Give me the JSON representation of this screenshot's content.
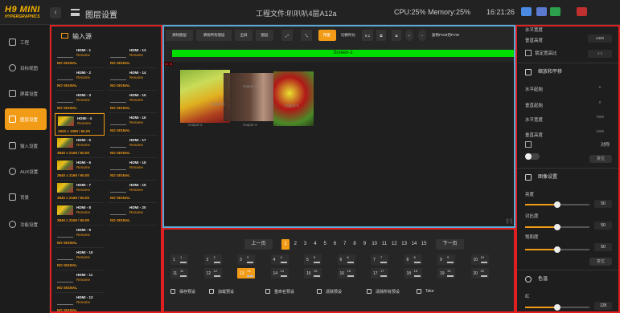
{
  "app": {
    "logo": "H9 MINI",
    "logo_sub": "HYPERGRAPHICS",
    "menu_title": "图层设置",
    "project": "工程文件:叭叭叭4层A12a",
    "cpu": "CPU:25% Memory:25%",
    "clock": "16:21:26"
  },
  "nav": {
    "items": [
      {
        "label": "工程"
      },
      {
        "label": "目标视图"
      },
      {
        "label": "屏幕设置"
      },
      {
        "label": "图层设置"
      },
      {
        "label": "输入设置"
      },
      {
        "label": "AUX设置"
      },
      {
        "label": "背景"
      },
      {
        "label": "功能设置"
      }
    ]
  },
  "sources": {
    "title": "输入源",
    "left": [
      {
        "name": "HDMI - 1",
        "rename": "Rename",
        "signal": "NO SIGNAL",
        "has": false
      },
      {
        "name": "HDMI - 2",
        "rename": "Rename",
        "signal": "NO SIGNAL",
        "has": false
      },
      {
        "name": "HDMI - 3",
        "rename": "Rename",
        "signal": "NO SIGNAL",
        "has": false
      },
      {
        "name": "HDMI - 4",
        "rename": "Rename",
        "signal": "1920 x 1080 / 60.00",
        "has": true
      },
      {
        "name": "HDMI - 5",
        "rename": "Rename",
        "signal": "3840 x 2160 / 60.00",
        "has": true
      },
      {
        "name": "HDMI - 6",
        "rename": "Rename",
        "signal": "3840 x 2160 / 60.00",
        "has": true
      },
      {
        "name": "HDMI - 7",
        "rename": "Rename",
        "signal": "3840 x 2160 / 60.00",
        "has": true
      },
      {
        "name": "HDMI - 8",
        "rename": "Rename",
        "signal": "3840 x 2160 / 60.00",
        "has": true
      },
      {
        "name": "HDMI - 9",
        "rename": "Rename",
        "signal": "NO SIGNAL",
        "has": false
      },
      {
        "name": "HDMI - 10",
        "rename": "Rename",
        "signal": "NO SIGNAL",
        "has": false
      },
      {
        "name": "HDMI - 11",
        "rename": "Rename",
        "signal": "NO SIGNAL",
        "has": false
      },
      {
        "name": "HDMI - 12",
        "rename": "Rename",
        "signal": "NO SIGNAL",
        "has": false
      }
    ],
    "right": [
      {
        "name": "HDMI - 13",
        "rename": "Rename",
        "signal": "NO SIGNAL"
      },
      {
        "name": "HDMI - 14",
        "rename": "Rename",
        "signal": "NO SIGNAL"
      },
      {
        "name": "HDMI - 15",
        "rename": "Rename",
        "signal": "NO SIGNAL"
      },
      {
        "name": "HDMI - 16",
        "rename": "Rename",
        "signal": "NO SIGNAL"
      },
      {
        "name": "HDMI - 17",
        "rename": "Rename",
        "signal": "NO SIGNAL"
      },
      {
        "name": "HDMI - 18",
        "rename": "Rename",
        "signal": "NO SIGNAL"
      },
      {
        "name": "HDMI - 19",
        "rename": "Rename",
        "signal": "NO SIGNAL"
      },
      {
        "name": "HDMI - 20",
        "rename": "Rename",
        "signal": "NO SIGNAL"
      }
    ]
  },
  "screen": {
    "toolbar": [
      "清除图层",
      "清除所有图层",
      "全屏",
      "图层",
      "预置-",
      "切换时长",
      "0.1"
    ],
    "toolbar_last": "复制PGM到PVW",
    "banner": "Screen-1",
    "coord": "(0, 0)",
    "outputs": [
      "Output-1",
      "Output-2",
      "Output-3",
      "Output-4",
      "Output-5"
    ],
    "zoom": "[□]"
  },
  "preset": {
    "prev": "上一页",
    "next": "下一页",
    "pages": [
      "1",
      "2",
      "3",
      "4",
      "5",
      "6",
      "7",
      "8",
      "9",
      "10",
      "11",
      "12",
      "13",
      "14",
      "15"
    ],
    "current_page": "1",
    "row1": [
      "1",
      "2",
      "3",
      "4",
      "5",
      "6",
      "7",
      "8",
      "9",
      "10"
    ],
    "row2": [
      "11",
      "12",
      "13",
      "14",
      "15",
      "16",
      "17",
      "18",
      "19",
      "20"
    ],
    "active": "13",
    "actions": [
      "保存预设",
      "加载预设",
      "重命名预设",
      "清除预设",
      "清除所有预设",
      "Take"
    ]
  },
  "right": {
    "items": [
      {
        "label": "水平宽度",
        "value": ""
      },
      {
        "label": "垂直高度",
        "value": "4320"
      },
      {
        "label": "锁定宽高比",
        "value": "4:3"
      }
    ],
    "scale_title": "缩放和平移",
    "scale": [
      {
        "label": "水平起始",
        "value": "0"
      },
      {
        "label": "垂直起始",
        "value": "0"
      },
      {
        "label": "水平宽度",
        "value": "7680"
      },
      {
        "label": "垂直高度",
        "value": "1080"
      }
    ],
    "symmetric": "对称",
    "reset": "复位",
    "image_title": "图像设置",
    "image": [
      {
        "label": "亮度",
        "value": "50",
        "pct": 0.5
      },
      {
        "label": "对比度",
        "value": "50",
        "pct": 0.5
      },
      {
        "label": "饱和度",
        "value": "50",
        "pct": 0.5
      }
    ],
    "reset2": "复位",
    "color_title": "色温",
    "red": {
      "label": "红",
      "value": "128",
      "pct": 0.5
    }
  }
}
